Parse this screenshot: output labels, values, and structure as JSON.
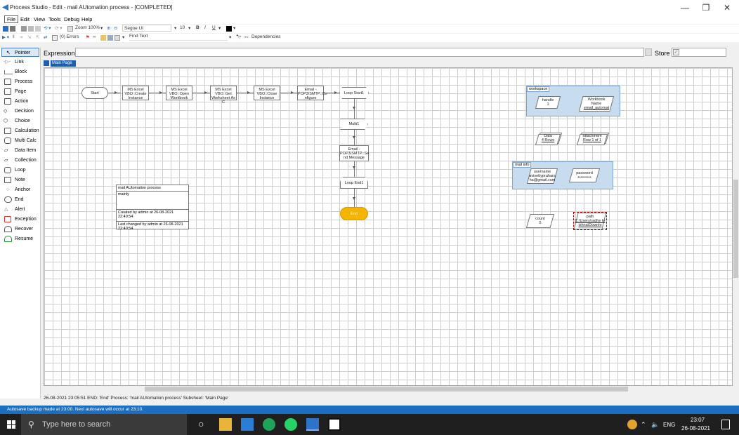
{
  "window": {
    "title": "Process Studio - Edit - mail AUtomation process - [COMPLETED]",
    "controls": {
      "minimize": "—",
      "restore": "❐",
      "close": "✕"
    }
  },
  "menus": [
    "File",
    "Edit",
    "View",
    "Tools",
    "Debug",
    "Help"
  ],
  "toolbar1": {
    "zoom": "Zoom 100%",
    "font": "Segoe UI",
    "font_size": "10",
    "bold": "B",
    "italic": "I",
    "underline": "U"
  },
  "toolbar2": {
    "errors": "(0) Errors",
    "find_text": "Find Text",
    "dependencies": "Dependencies"
  },
  "palette": [
    "Pointer",
    "Link",
    "Block",
    "Process",
    "Page",
    "Action",
    "Decision",
    "Choice",
    "Calculation",
    "Multi Calc",
    "Data Item",
    "Collection",
    "Loop",
    "Note",
    "Anchor",
    "End",
    "Alert",
    "Exception",
    "Recover",
    "Resume"
  ],
  "expression": {
    "label": "Expression:",
    "store_label": "Store In:",
    "value": ""
  },
  "page_tab": "Main Page",
  "flow": {
    "start": "Start",
    "actions": [
      "MS Excel VBO::Create Instance",
      "MS Excel VBO::Open Workbook",
      "MS Excel VBO::Get Worksheet As C",
      "MS Excel VBO::Close Instance",
      "Email - POP3/SMTP::Co nfigure"
    ],
    "loop_start": "Loop Start1",
    "multi": "Multi1",
    "send_message": "Email - POP3/SMTP::Se nd Message",
    "loop_end": "Loop End1",
    "end": "End"
  },
  "workspace_block": {
    "label": "workspace",
    "items": [
      {
        "name": "handle",
        "value": "1"
      },
      {
        "name": "Workbook Name",
        "value": "email_automat"
      }
    ]
  },
  "collections": [
    {
      "name": "Data",
      "value": "4 Rows"
    },
    {
      "name": "attachment",
      "value": "Row 1 of 1"
    }
  ],
  "mail_info_block": {
    "label": "mail info",
    "items": [
      {
        "name": "username",
        "value": "avisettypraharsha@gmail.com"
      },
      {
        "name": "password",
        "value": "••••••••••"
      }
    ]
  },
  "other_items": [
    {
      "name": "count",
      "value": "5"
    },
    {
      "name": "path",
      "value": "C:\\Users\\radhe krishna\\Downlo"
    }
  ],
  "process_note": {
    "title": "mail AUtomation process",
    "description": "mainly",
    "created": "Created by admin at 26-08-2021 22:40:54",
    "changed": "Last changed by admin at 26-08-2021 22:40:54"
  },
  "status": {
    "log": "26-08-2021 23:05:51 END: 'End' Process: 'mail AUtomation process' Subsheet: 'Main Page'",
    "autosave": "Autosave backup made at 23:00. Next autosave will occur at 23:10."
  },
  "taskbar": {
    "search_placeholder": "Type here to search",
    "language": "ENG",
    "time": "23:07",
    "date": "26-08-2021"
  },
  "colors": {
    "accent": "#1a5fb4",
    "end_node": "#f5b400",
    "block_fill": "#c8dcf0",
    "status_bar": "#1b6ec2"
  }
}
